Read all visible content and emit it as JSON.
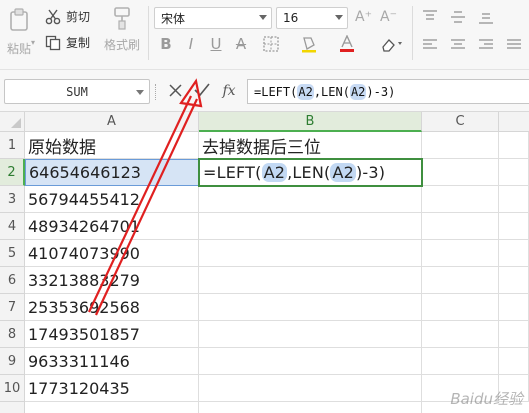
{
  "ribbon": {
    "paste_label": "粘贴",
    "cut_label": "剪切",
    "copy_label": "复制",
    "format_painter_label": "格式刷",
    "font_name": "宋体",
    "font_size": "16",
    "grow_font": "A⁺",
    "shrink_font": "A⁻",
    "bold": "B",
    "italic": "I",
    "underline": "U",
    "strike": "A"
  },
  "formula_bar": {
    "name_box": "SUM",
    "fx_label": "fx",
    "formula_prefix": "=LEFT(",
    "ref1": "A2",
    "formula_mid": ",LEN(",
    "ref2": "A2",
    "formula_suffix": ")-3)"
  },
  "grid": {
    "columns": [
      "A",
      "B",
      "C"
    ],
    "rows": [
      "1",
      "2",
      "3",
      "4",
      "5",
      "6",
      "7",
      "8",
      "9",
      "10"
    ],
    "a1": "原始数据",
    "b1": "去掉数据后三位",
    "column_a_values": [
      "64654646123",
      "56794455412",
      "48934264701",
      "41074073990",
      "33213883279",
      "25353692568",
      "17493501857",
      "9633311146",
      "1773120435"
    ],
    "b2_prefix": "=LEFT(",
    "b2_ref1": "A2",
    "b2_mid": ",LEN(",
    "b2_ref2": "A2",
    "b2_suffix": ")-3)"
  },
  "colors": {
    "accent_green": "#4caf50",
    "reference_blue": "#c7daf4",
    "annotation_red": "#e02020"
  },
  "watermark": "Baidu经验"
}
